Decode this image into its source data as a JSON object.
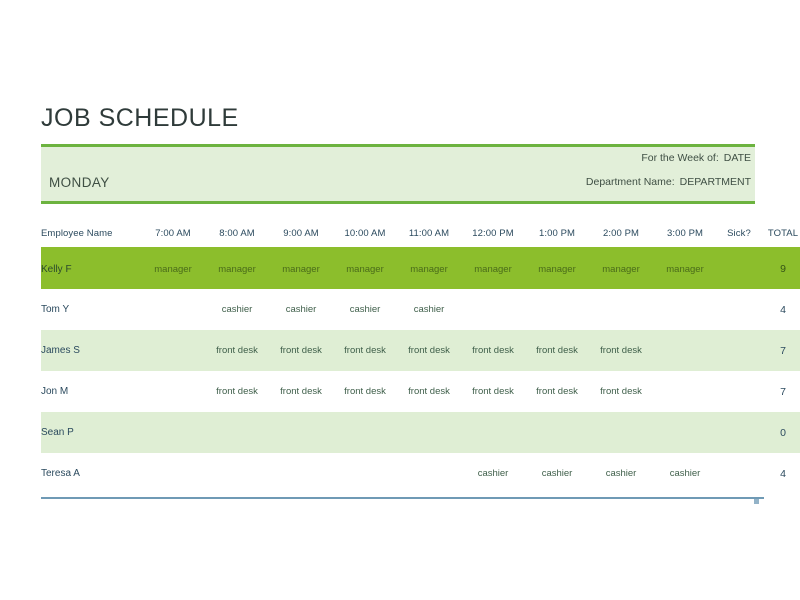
{
  "document": {
    "title": "JOB SCHEDULE",
    "day": "MONDAY"
  },
  "meta": {
    "week_label": "For the Week of:",
    "week_value": "DATE",
    "department_label": "Department Name:",
    "department_value": "DEPARTMENT"
  },
  "table": {
    "columns": [
      "Employee Name",
      "7:00 AM",
      "8:00 AM",
      "9:00 AM",
      "10:00 AM",
      "11:00 AM",
      "12:00 PM",
      "1:00 PM",
      "2:00 PM",
      "3:00 PM",
      "Sick?",
      "TOTAL"
    ],
    "rows": [
      {
        "name": "Kelly F",
        "style": "row-highlight",
        "slots": [
          "manager",
          "manager",
          "manager",
          "manager",
          "manager",
          "manager",
          "manager",
          "manager",
          "manager"
        ],
        "sick": "",
        "total": "9"
      },
      {
        "name": "Tom Y",
        "style": "row-plain",
        "slots": [
          "",
          "cashier",
          "cashier",
          "cashier",
          "cashier",
          "",
          "",
          "",
          ""
        ],
        "sick": "",
        "total": "4"
      },
      {
        "name": "James S",
        "style": "row-tint",
        "slots": [
          "",
          "front desk",
          "front desk",
          "front desk",
          "front desk",
          "front desk",
          "front desk",
          "front desk",
          ""
        ],
        "sick": "",
        "total": "7"
      },
      {
        "name": "Jon M",
        "style": "row-plain",
        "slots": [
          "",
          "front desk",
          "front desk",
          "front desk",
          "front desk",
          "front desk",
          "front desk",
          "front desk",
          ""
        ],
        "sick": "",
        "total": "7"
      },
      {
        "name": "Sean P",
        "style": "row-tint",
        "slots": [
          "",
          "",
          "",
          "",
          "",
          "",
          "",
          "",
          ""
        ],
        "sick": "",
        "total": "0"
      },
      {
        "name": "Teresa A",
        "style": "row-plain",
        "slots": [
          "",
          "",
          "",
          "",
          "",
          "cashier",
          "cashier",
          "cashier",
          "cashier"
        ],
        "sick": "",
        "total": "4"
      }
    ]
  },
  "colors": {
    "accent_green": "#6cb33f",
    "banner_bg": "#e2efd9",
    "highlight_row": "#8cbe2c",
    "tint_row": "#dfeed4",
    "header_text": "#2b4a5e",
    "bottom_rule": "#6f9ab5"
  }
}
